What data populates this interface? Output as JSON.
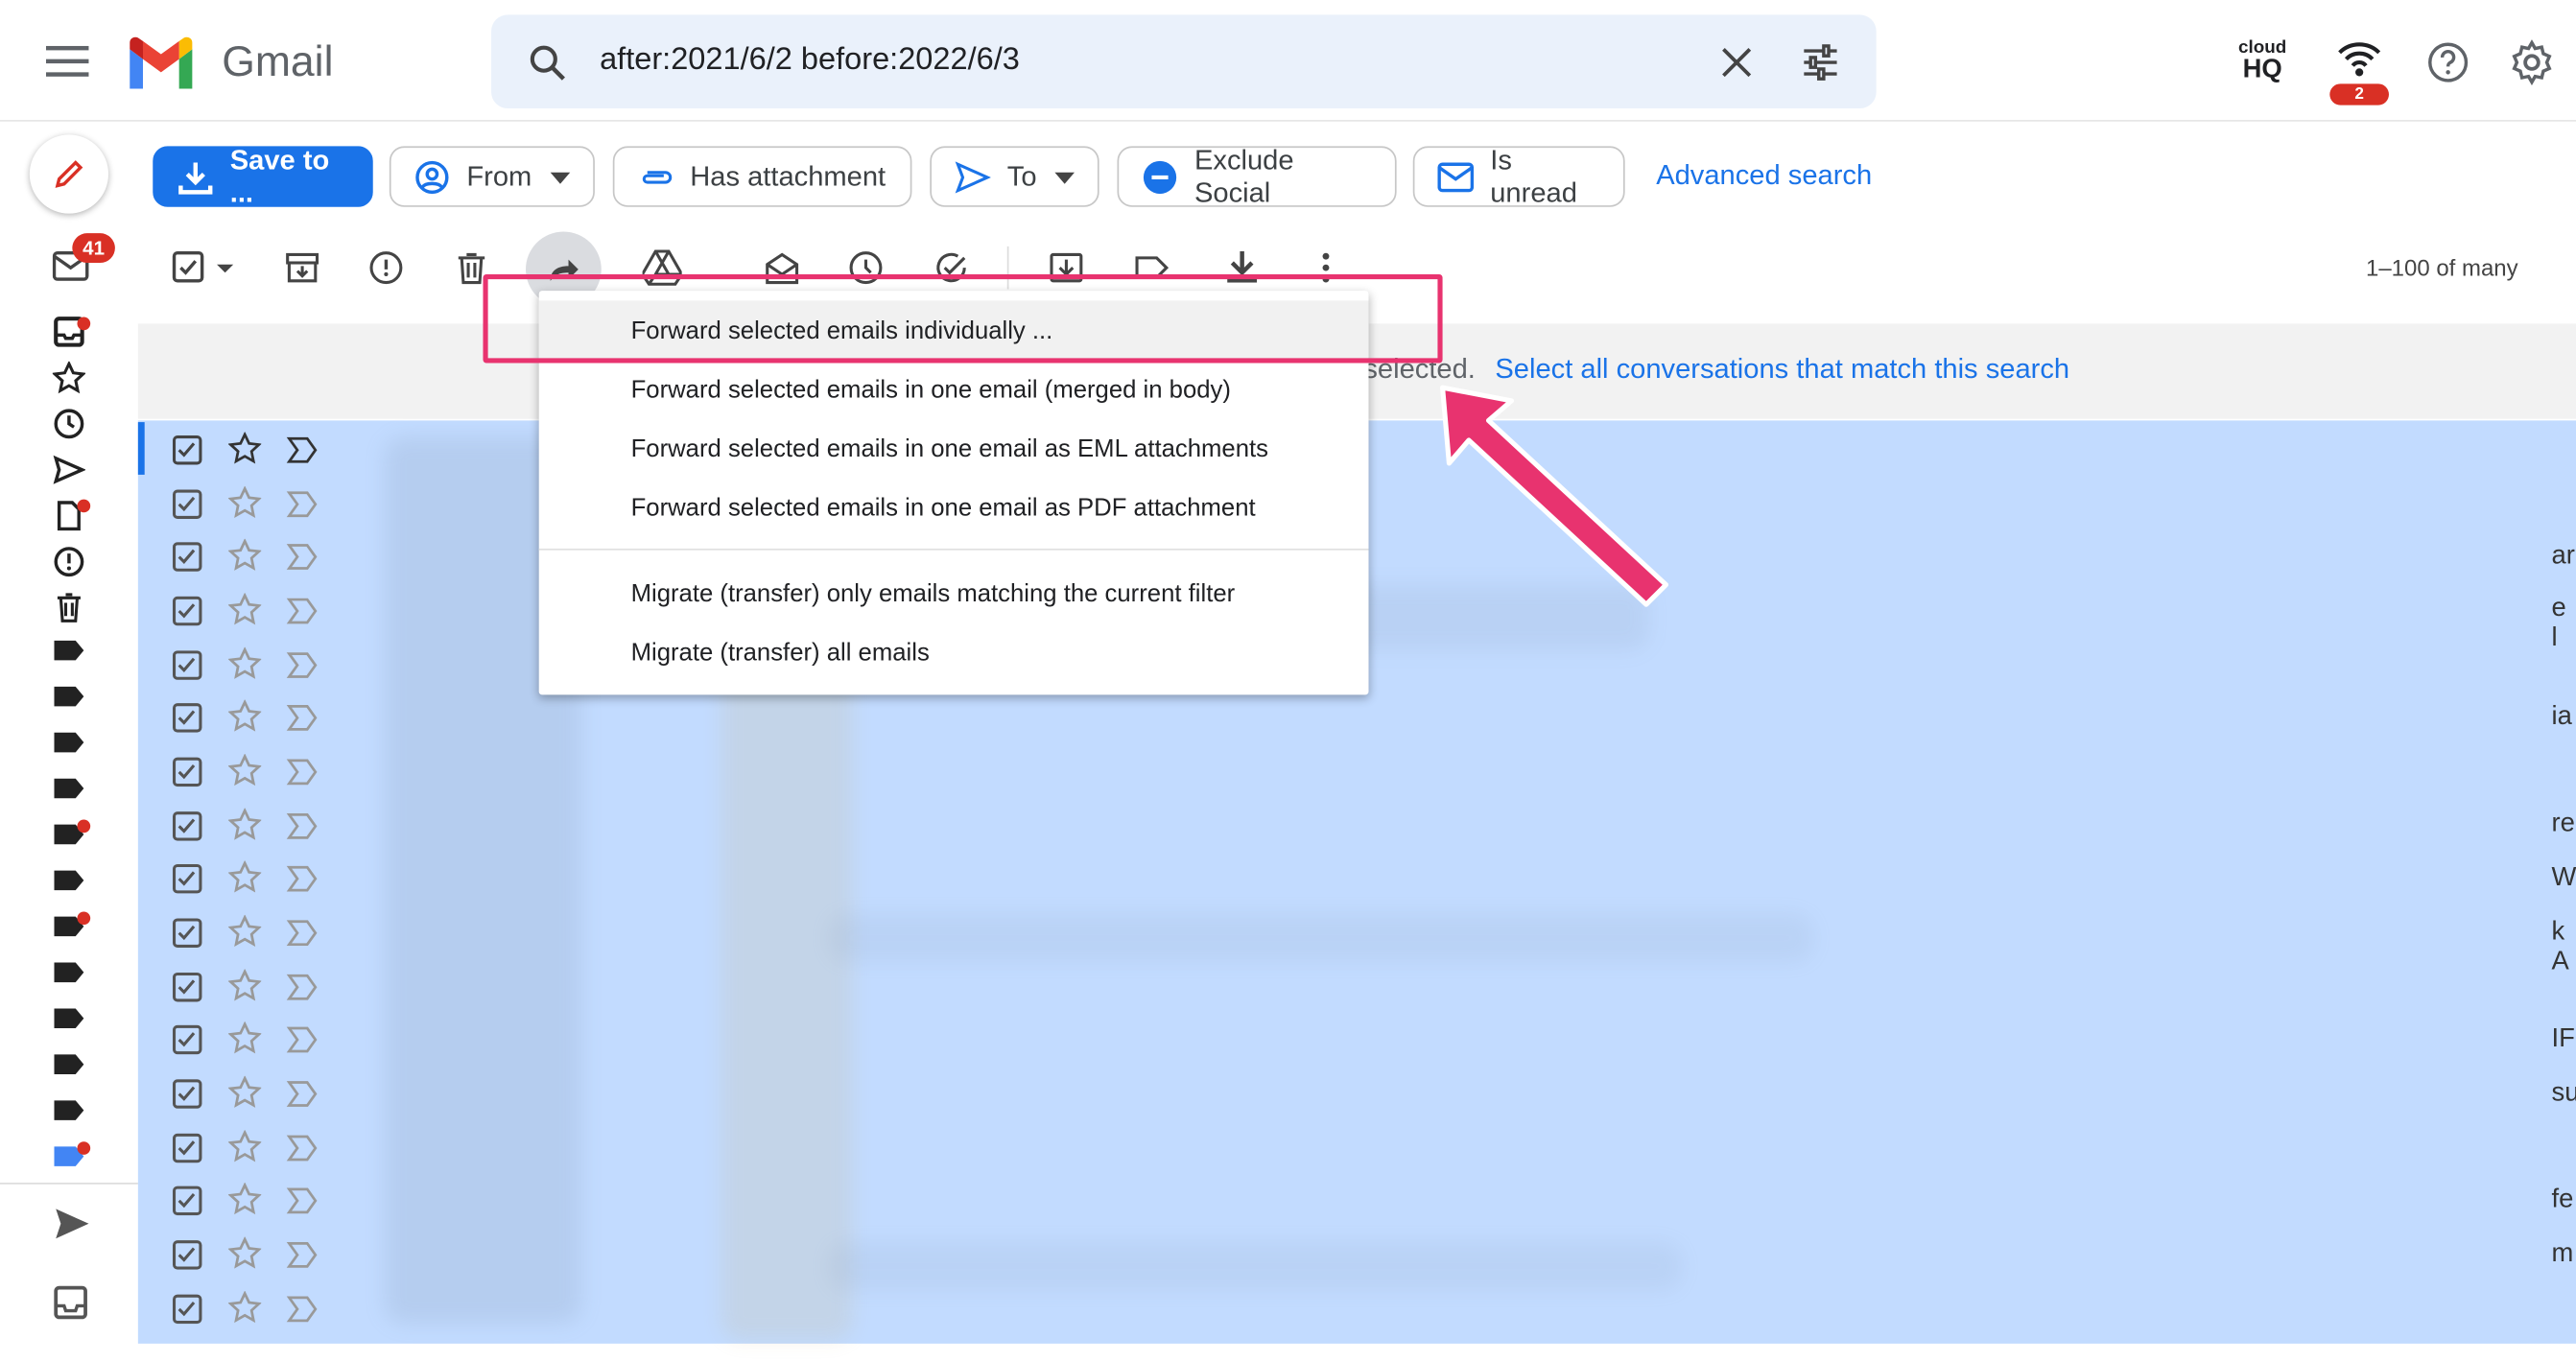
{
  "app": {
    "name": "Gmail"
  },
  "search": {
    "query": "after:2021/6/2 before:2022/6/3"
  },
  "header": {
    "cloudhq_top": "cloud",
    "cloudhq_bottom": "HQ",
    "wifi_badge": "2"
  },
  "chips": {
    "save": "Save to ...",
    "from": "From",
    "has_attachment": "Has attachment",
    "to": "To",
    "exclude_social": "Exclude Social",
    "is_unread": "Is unread",
    "advanced": "Advanced search"
  },
  "nav": {
    "inbox_badge": "41"
  },
  "toolbar": {
    "pager": "1–100 of many"
  },
  "banner": {
    "selected_text": "selected.",
    "select_all_link": "Select all conversations that match this search"
  },
  "menu": {
    "items": [
      "Forward selected emails individually ...",
      "Forward selected emails in one email (merged in body)",
      "Forward selected emails in one email as EML attachments",
      "Forward selected emails in one email as PDF attachment",
      "Migrate (transfer) only emails matching the current filter",
      "Migrate (transfer) all emails"
    ]
  },
  "edge_letters": [
    "ar",
    "e l",
    "ia",
    "re",
    "W",
    "k A",
    "IF",
    "su",
    "fe",
    "m"
  ],
  "colors": {
    "accent": "#1a73e8",
    "selected_row": "#c2dbff",
    "highlight": "#e8336f",
    "badge": "#d93025"
  },
  "icons": [
    "menu-icon",
    "gmail-logo",
    "search-icon",
    "close-icon",
    "tune-icon",
    "wifi-icon",
    "help-icon",
    "gear-icon",
    "pencil-icon",
    "download-icon",
    "person-icon",
    "paperclip-icon",
    "send-icon",
    "minus-icon",
    "mail-icon",
    "checkbox-icon",
    "archive-icon",
    "report-icon",
    "trash-icon",
    "forward-icon",
    "drive-icon",
    "open-mail-icon",
    "clock-icon",
    "add-task-icon",
    "move-to-icon",
    "label-icon",
    "more-icon",
    "star-icon",
    "important-icon",
    "arrow-icon"
  ]
}
